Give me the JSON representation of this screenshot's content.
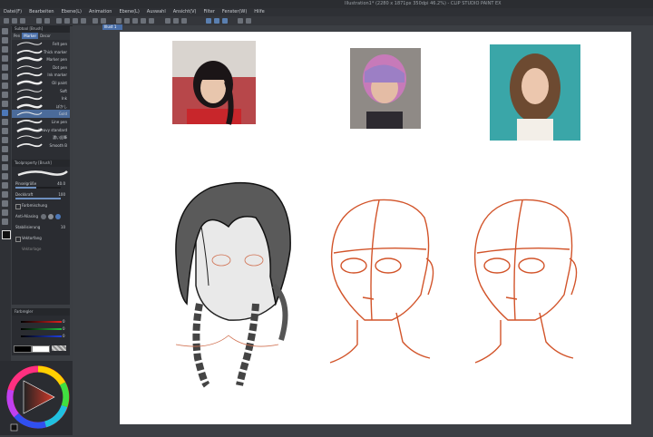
{
  "window": {
    "title": "Illustration1* (2280 x 1871px 350dpi 46.2%)  - CLIP STUDIO PAINT EX"
  },
  "menu": [
    "Datei(F)",
    "Bearbeiten",
    "Ebene(L)",
    "Animation",
    "Ebene(L)",
    "Auswahl",
    "Ansicht(V)",
    "Filter",
    "Fenster(W)",
    "Hilfe"
  ],
  "subtool_panel": {
    "header": "Subtool [Brush]",
    "tabs": [
      "Pen",
      "Marker",
      "Decor"
    ],
    "brushes": [
      {
        "label": "Felt pen"
      },
      {
        "label": "Thick marker"
      },
      {
        "label": "Marker pen"
      },
      {
        "label": "Dot pen"
      },
      {
        "label": "Ink marker"
      },
      {
        "label": "Oil paint"
      },
      {
        "label": "Soft"
      },
      {
        "label": "Ink"
      },
      {
        "label": "ぼかし"
      },
      {
        "label": "Gold"
      },
      {
        "label": "Line pen"
      },
      {
        "label": "Heavy standard"
      },
      {
        "label": "濃い鉛筆"
      },
      {
        "label": "Smooth B"
      }
    ],
    "selected_index": 9
  },
  "tool_property": {
    "header": "Toolproperty [Brush]",
    "rows": [
      {
        "label": "Pinselgröße",
        "value": "40.0",
        "fill": 0.45
      },
      {
        "label": "Deckkraft",
        "value": "100",
        "fill": 1.0
      },
      {
        "label": "Farbmischung",
        "value": ""
      },
      {
        "label": "Anti-Aliasing",
        "value": ""
      },
      {
        "label": "Stabilisierung",
        "value": "10",
        "fill": 0.2
      },
      {
        "label": "Vektorfang",
        "value": ""
      },
      {
        "label": "Vektorlage",
        "value": ""
      }
    ]
  },
  "color_slider": {
    "header": "Farbregler",
    "values": [
      "0",
      "0",
      "0"
    ]
  },
  "document_tab": "Illust 1",
  "colors": {
    "accent": "#4a6fa8",
    "sketch_orange": "#d2542a",
    "wheel_red": "#d43a2a"
  }
}
